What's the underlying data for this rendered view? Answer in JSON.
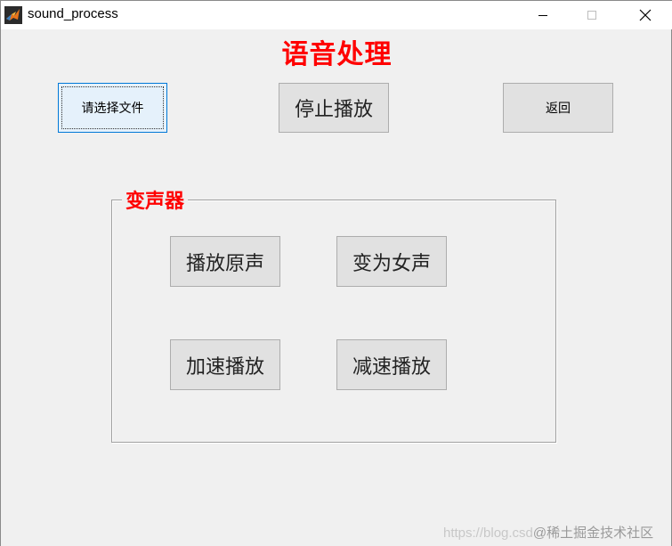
{
  "window": {
    "title": "sound_process",
    "controls": {
      "minimize_icon": "minimize-icon",
      "maximize_icon": "maximize-icon",
      "close_icon": "close-icon"
    }
  },
  "main": {
    "title": "语音处理",
    "title_color": "#ff0000",
    "buttons": {
      "select_file": "请选择文件",
      "stop_play": "停止播放",
      "back": "返回"
    }
  },
  "voice_changer": {
    "title": "变声器",
    "buttons": {
      "play_original": "播放原声",
      "to_female": "变为女声",
      "speed_up": "加速播放",
      "slow_down": "减速播放"
    }
  },
  "watermark": {
    "url": "https://blog.csd",
    "community": "@稀土掘金技术社区"
  },
  "colors": {
    "accent": "#ff0000",
    "focus_border": "#0078d7",
    "button_bg": "#e1e1e1"
  }
}
